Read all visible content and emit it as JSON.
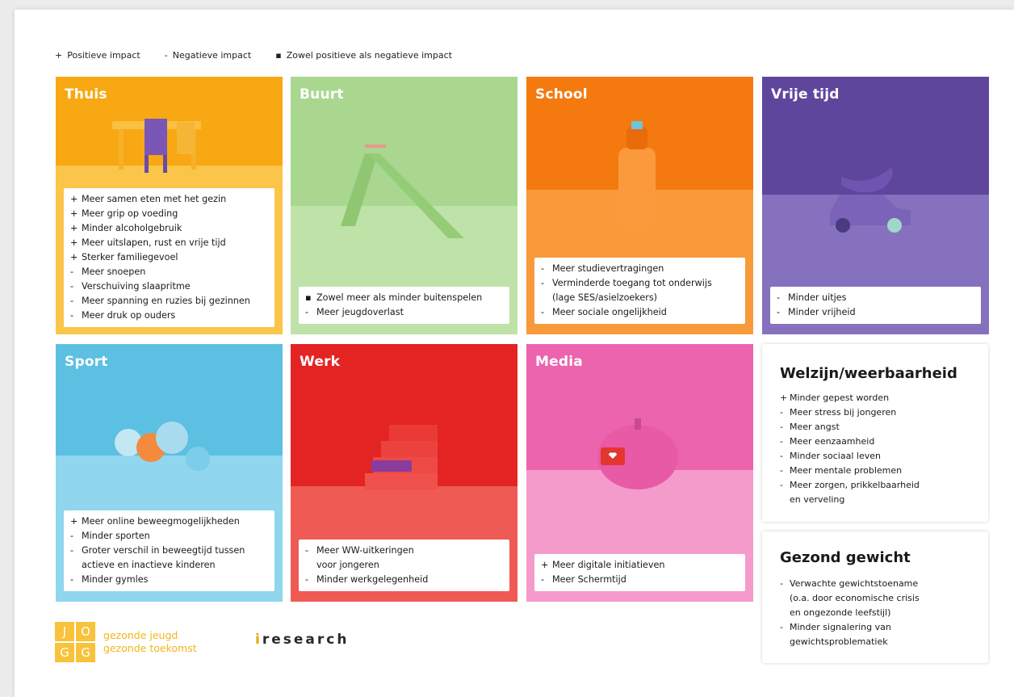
{
  "legend": [
    {
      "symbol": "+",
      "label": "Positieve impact"
    },
    {
      "symbol": "-",
      "label": "Negatieve impact"
    },
    {
      "symbol": "▪",
      "label": "Zowel positieve als negatieve impact"
    }
  ],
  "cards": {
    "thuis": {
      "title": "Thuis",
      "color": "#f9b319",
      "items": [
        {
          "s": "+",
          "t": "Meer samen eten met het gezin"
        },
        {
          "s": "+",
          "t": "Meer grip op voeding"
        },
        {
          "s": "+",
          "t": "Minder alcoholgebruik"
        },
        {
          "s": "+",
          "t": "Meer uitslapen, rust en vrije tijd"
        },
        {
          "s": "+",
          "t": "Sterker familiegevoel"
        },
        {
          "s": "-",
          "t": "Meer snoepen"
        },
        {
          "s": "-",
          "t": "Verschuiving slaapritme"
        },
        {
          "s": "-",
          "t": "Meer spanning en ruzies bij gezinnen"
        },
        {
          "s": "-",
          "t": "Meer druk op ouders"
        }
      ]
    },
    "buurt": {
      "title": "Buurt",
      "color": "#9fd184",
      "items": [
        {
          "s": "▪",
          "t": "Zowel meer als minder buitenspelen"
        },
        {
          "s": "-",
          "t": "Meer jeugdoverlast"
        }
      ]
    },
    "school": {
      "title": "School",
      "color": "#f7861b",
      "items": [
        {
          "s": "-",
          "t": "Meer studievertragingen"
        },
        {
          "s": "-",
          "t": "Verminderde toegang tot onderwijs"
        },
        {
          "s": "",
          "t": "(lage SES/asielzoekers)"
        },
        {
          "s": "-",
          "t": "Meer sociale ongelijkheid"
        }
      ]
    },
    "vrije_tijd": {
      "title": "Vrije tijd",
      "color": "#6a50a8",
      "items": [
        {
          "s": "-",
          "t": "Minder uitjes"
        },
        {
          "s": "-",
          "t": "Minder vrijheid"
        }
      ]
    },
    "sport": {
      "title": "Sport",
      "color": "#66c5e6",
      "items": [
        {
          "s": "+",
          "t": "Meer online beweegmogelijkheden"
        },
        {
          "s": "-",
          "t": "Minder sporten"
        },
        {
          "s": "-",
          "t": "Groter verschil in beweegtijd tussen"
        },
        {
          "s": "",
          "t": "actieve en inactieve kinderen"
        },
        {
          "s": "-",
          "t": "Minder gymles"
        }
      ]
    },
    "werk": {
      "title": "Werk",
      "color": "#e8322f",
      "items": [
        {
          "s": "-",
          "t": "Meer WW-uitkeringen"
        },
        {
          "s": "",
          "t": "voor jongeren"
        },
        {
          "s": "-",
          "t": "Minder werkgelegenheid"
        }
      ]
    },
    "media": {
      "title": "Media",
      "color": "#ee73b5",
      "items": [
        {
          "s": "+",
          "t": "Meer digitale initiatieven"
        },
        {
          "s": "-",
          "t": "Meer Schermtijd"
        }
      ]
    }
  },
  "welzijn": {
    "title": "Welzijn/weerbaarheid",
    "items": [
      {
        "s": "+",
        "t": "Minder gepest worden"
      },
      {
        "s": "-",
        "t": "Meer stress bij jongeren"
      },
      {
        "s": "-",
        "t": "Meer angst"
      },
      {
        "s": "-",
        "t": "Meer eenzaamheid"
      },
      {
        "s": "-",
        "t": "Minder sociaal leven"
      },
      {
        "s": "-",
        "t": "Meer mentale problemen"
      },
      {
        "s": "-",
        "t": "Meer zorgen, prikkelbaarheid"
      },
      {
        "s": "",
        "t": "en verveling"
      }
    ]
  },
  "gewicht": {
    "title": "Gezond gewicht",
    "items": [
      {
        "s": "-",
        "t": "Verwachte gewichtstoename"
      },
      {
        "s": "",
        "t": "(o.a. door economische crisis"
      },
      {
        "s": "",
        "t": "en ongezonde leefstijl)"
      },
      {
        "s": "-",
        "t": "Minder signalering van"
      },
      {
        "s": "",
        "t": "gewichtsproblematiek"
      }
    ]
  },
  "logos": {
    "jogg_letters": [
      "J",
      "O",
      "G",
      "G"
    ],
    "jogg_line1": "gezonde jeugd",
    "jogg_line2": "gezonde toekomst",
    "iresearch_i": "i",
    "iresearch_rest": "research"
  }
}
